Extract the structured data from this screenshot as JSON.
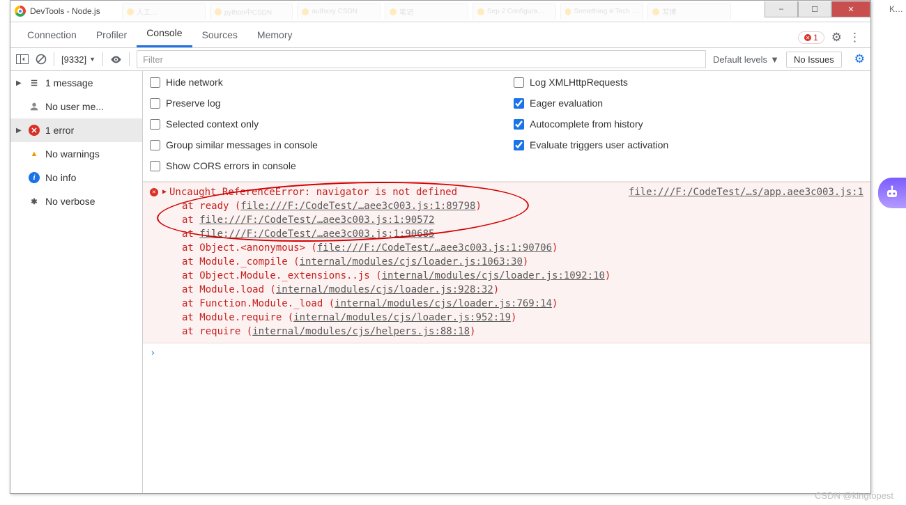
{
  "window": {
    "title": "DevTools - Node.js",
    "min_icon": "–",
    "max_icon": "☐",
    "close_icon": "✕"
  },
  "browser_tabs": [
    "人工…",
    "python中CSDN",
    "authxxy CSDN",
    "笔记",
    "Sep 2 Configura…",
    "Something #:Tech …",
    "写博"
  ],
  "topbar": {
    "tabs": {
      "connection": "Connection",
      "profiler": "Profiler",
      "console": "Console",
      "sources": "Sources",
      "memory": "Memory"
    },
    "error_count": "1",
    "gear_icon": "⚙",
    "more_icon": "⋮"
  },
  "toolbar": {
    "context_label": "[9332]",
    "filter_placeholder": "Filter",
    "levels_label": "Default levels",
    "issues_label": "No Issues"
  },
  "sidebar": {
    "items": [
      {
        "icon": "list",
        "label": "1 message",
        "caret": true
      },
      {
        "icon": "user",
        "label": "No user me...",
        "caret": false
      },
      {
        "icon": "err",
        "label": "1 error",
        "caret": true,
        "selected": true
      },
      {
        "icon": "warn",
        "label": "No warnings",
        "caret": false
      },
      {
        "icon": "info",
        "label": "No info",
        "caret": false
      },
      {
        "icon": "verbose",
        "label": "No verbose",
        "caret": false
      }
    ]
  },
  "settings": {
    "left": [
      {
        "label": "Hide network",
        "checked": false
      },
      {
        "label": "Preserve log",
        "checked": false
      },
      {
        "label": "Selected context only",
        "checked": false
      },
      {
        "label": "Group similar messages in console",
        "checked": false
      },
      {
        "label": "Show CORS errors in console",
        "checked": false
      }
    ],
    "right": [
      {
        "label": "Log XMLHttpRequests",
        "checked": false
      },
      {
        "label": "Eager evaluation",
        "checked": true
      },
      {
        "label": "Autocomplete from history",
        "checked": true
      },
      {
        "label": "Evaluate triggers user activation",
        "checked": true
      }
    ]
  },
  "error": {
    "headline": "Uncaught ReferenceError: navigator is not defined",
    "source_link": "file:///F:/CodeTest/…s/app.aee3c003.js:1",
    "stack": [
      {
        "pre": "at ready (",
        "link": "file:///F:/CodeTest/…aee3c003.js:1:89798",
        "post": ")"
      },
      {
        "pre": "at ",
        "link": "file:///F:/CodeTest/…aee3c003.js:1:90572",
        "post": ""
      },
      {
        "pre": "at ",
        "link": "file:///F:/CodeTest/…aee3c003.js:1:90685",
        "post": ""
      },
      {
        "pre": "at Object.<anonymous> (",
        "link": "file:///F:/CodeTest/…aee3c003.js:1:90706",
        "post": ")"
      },
      {
        "pre": "at Module._compile (",
        "link": "internal/modules/cjs/loader.js:1063:30",
        "post": ")"
      },
      {
        "pre": "at Object.Module._extensions..js (",
        "link": "internal/modules/cjs/loader.js:1092:10",
        "post": ")"
      },
      {
        "pre": "at Module.load (",
        "link": "internal/modules/cjs/loader.js:928:32",
        "post": ")"
      },
      {
        "pre": "at Function.Module._load (",
        "link": "internal/modules/cjs/loader.js:769:14",
        "post": ")"
      },
      {
        "pre": "at Module.require (",
        "link": "internal/modules/cjs/loader.js:952:19",
        "post": ")"
      },
      {
        "pre": "at require (",
        "link": "internal/modules/cjs/helpers.js:88:18",
        "post": ")"
      }
    ]
  },
  "prompt": "›",
  "watermark": "CSDN @kingtopest",
  "ktext": "K…"
}
